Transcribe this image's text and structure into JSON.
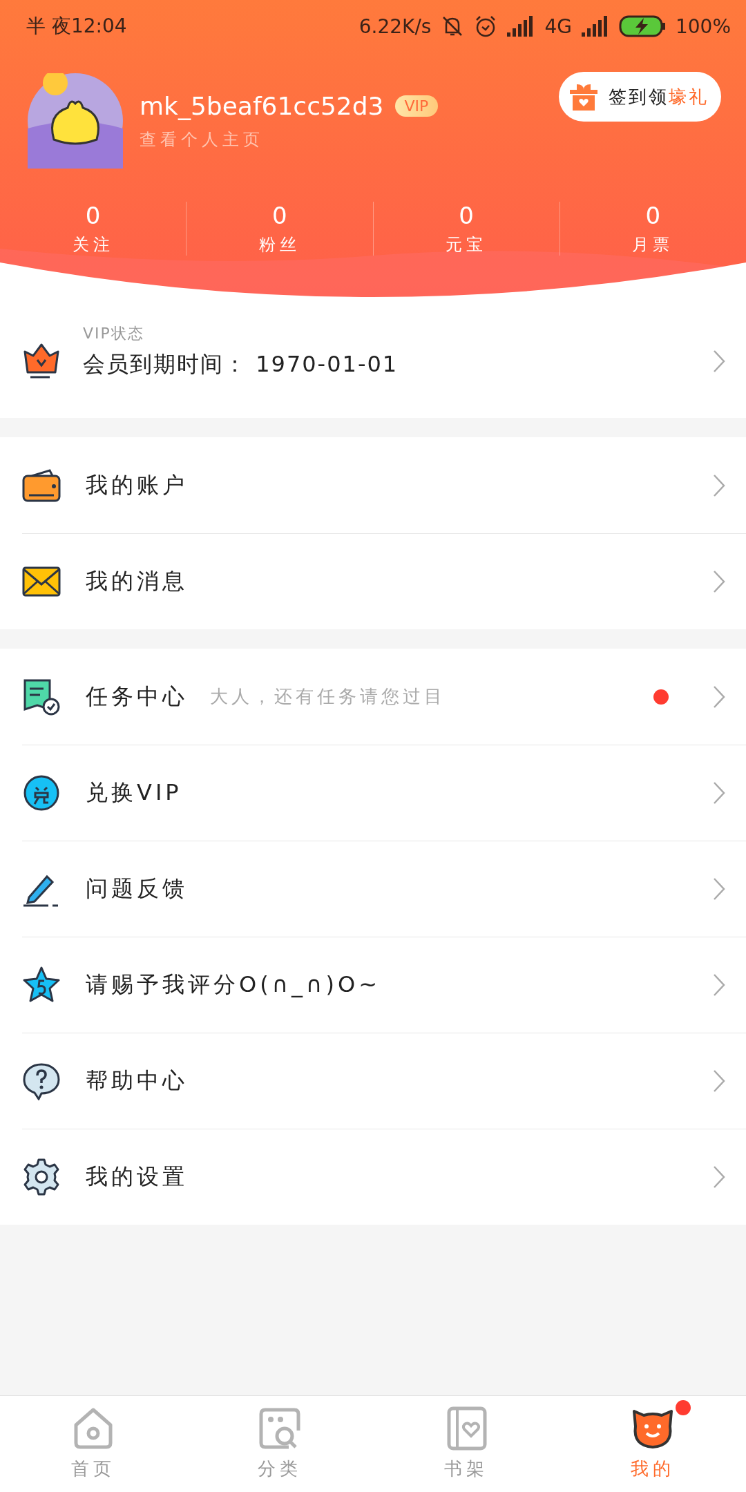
{
  "status_bar": {
    "time": "半 夜12:04",
    "speed": "6.22K/s",
    "network": "4G",
    "battery": "100%"
  },
  "profile": {
    "username": "mk_5beaf61cc52d3",
    "vip_badge": "VIP",
    "subtitle": "查看个人主页",
    "checkin": {
      "text": "签到领",
      "highlight": "壕礼"
    }
  },
  "stats": [
    {
      "value": "0",
      "label": "关注"
    },
    {
      "value": "0",
      "label": "粉丝"
    },
    {
      "value": "0",
      "label": "元宝"
    },
    {
      "value": "0",
      "label": "月票"
    }
  ],
  "vip_status": {
    "label": "VIP状态",
    "text": "会员到期时间： 1970-01-01"
  },
  "groups": [
    [
      {
        "label": "我的账户",
        "unread": false
      },
      {
        "label": "我的消息",
        "unread": false
      }
    ],
    [
      {
        "label": "任务中心",
        "hint": "大人，还有任务请您过目",
        "unread": true
      },
      {
        "label": "兑换VIP",
        "unread": false
      },
      {
        "label": "问题反馈",
        "unread": false
      },
      {
        "label": "请赐予我评分O(∩_∩)O~",
        "unread": false
      },
      {
        "label": "帮助中心",
        "unread": false
      },
      {
        "label": "我的设置",
        "unread": false
      }
    ]
  ],
  "nav": [
    {
      "label": "首页",
      "selected": false,
      "badge": false
    },
    {
      "label": "分类",
      "selected": false,
      "badge": false
    },
    {
      "label": "书架",
      "selected": false,
      "badge": false
    },
    {
      "label": "我的",
      "selected": true,
      "badge": true
    }
  ]
}
